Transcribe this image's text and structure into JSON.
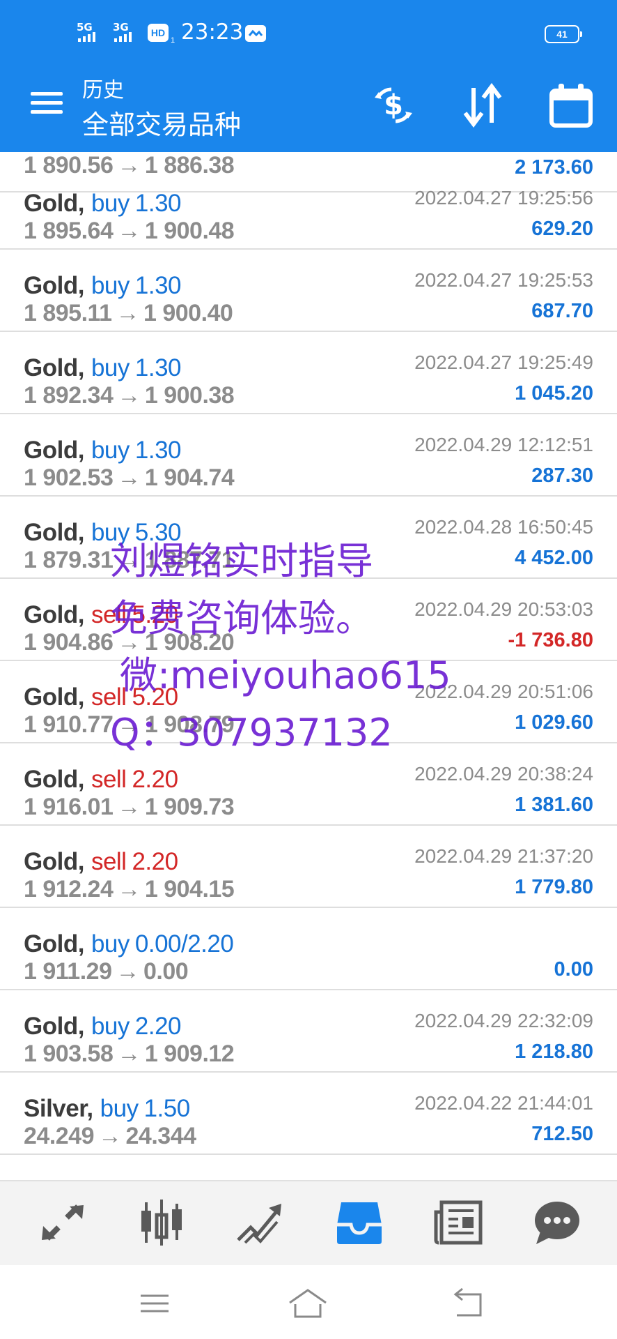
{
  "status_bar": {
    "sim1": "5G",
    "sim2": "3G",
    "hd": "HD",
    "hd_sub": "1",
    "time": "23:23",
    "battery": "41"
  },
  "header": {
    "title": "历史",
    "subtitle": "全部交易品种",
    "icons": [
      "menu-icon",
      "currency-exchange-icon",
      "sort-icon",
      "calendar-icon"
    ]
  },
  "deals": [
    {
      "symbol": "",
      "direction": "",
      "volume": "",
      "open_price": "1 890.56",
      "close_price": "1 886.38",
      "time": "",
      "profit": "2 173.60"
    },
    {
      "symbol": "Gold,",
      "direction": "buy",
      "volume": "1.30",
      "open_price": "1 895.64",
      "close_price": "1 900.48",
      "time": "2022.04.27 19:25:56",
      "profit": "629.20"
    },
    {
      "symbol": "Gold,",
      "direction": "buy",
      "volume": "1.30",
      "open_price": "1 895.11",
      "close_price": "1 900.40",
      "time": "2022.04.27 19:25:53",
      "profit": "687.70"
    },
    {
      "symbol": "Gold,",
      "direction": "buy",
      "volume": "1.30",
      "open_price": "1 892.34",
      "close_price": "1 900.38",
      "time": "2022.04.27 19:25:49",
      "profit": "1 045.20"
    },
    {
      "symbol": "Gold,",
      "direction": "buy",
      "volume": "1.30",
      "open_price": "1 902.53",
      "close_price": "1 904.74",
      "time": "2022.04.29 12:12:51",
      "profit": "287.30"
    },
    {
      "symbol": "Gold,",
      "direction": "buy",
      "volume": "5.30",
      "open_price": "1 879.31",
      "close_price": "1 887.71",
      "time": "2022.04.28 16:50:45",
      "profit": "4 452.00"
    },
    {
      "symbol": "Gold,",
      "direction": "sell",
      "volume": "5.20",
      "open_price": "1 904.86",
      "close_price": "1 908.20",
      "time": "2022.04.29 20:53:03",
      "profit": "-1 736.80"
    },
    {
      "symbol": "Gold,",
      "direction": "sell",
      "volume": "5.20",
      "open_price": "1 910.77",
      "close_price": "1 908.79",
      "time": "2022.04.29 20:51:06",
      "profit": "1 029.60"
    },
    {
      "symbol": "Gold,",
      "direction": "sell",
      "volume": "2.20",
      "open_price": "1 916.01",
      "close_price": "1 909.73",
      "time": "2022.04.29 20:38:24",
      "profit": "1 381.60"
    },
    {
      "symbol": "Gold,",
      "direction": "sell",
      "volume": "2.20",
      "open_price": "1 912.24",
      "close_price": "1 904.15",
      "time": "2022.04.29 21:37:20",
      "profit": "1 779.80"
    },
    {
      "symbol": "Gold,",
      "direction": "buy",
      "volume": "0.00/2.20",
      "open_price": "1 911.29",
      "close_price": "0.00",
      "time": "",
      "profit": "0.00"
    },
    {
      "symbol": "Gold,",
      "direction": "buy",
      "volume": "2.20",
      "open_price": "1 903.58",
      "close_price": "1 909.12",
      "time": "2022.04.29 22:32:09",
      "profit": "1 218.80"
    },
    {
      "symbol": "Silver,",
      "direction": "buy",
      "volume": "1.50",
      "open_price": "24.249",
      "close_price": "24.344",
      "time": "2022.04.22 21:44:01",
      "profit": "712.50"
    }
  ],
  "arrow": "→",
  "watermark": {
    "line1": "刘煜铭实时指导",
    "line2": "免费咨询体验。",
    "line3": "微:meiyouhao615",
    "line4": "Q：307937132"
  },
  "bottom_nav": {
    "items": [
      "quotes-icon",
      "chart-icon",
      "trade-icon",
      "history-icon",
      "news-icon",
      "chat-icon"
    ],
    "active": "history-icon",
    "active_color": "#1a86ec",
    "inactive_color": "#5a5a5a"
  },
  "colors": {
    "header_bg": "#1a86ec",
    "buy": "#1673d6",
    "sell": "#d32727",
    "watermark": "#6a1bd2"
  }
}
